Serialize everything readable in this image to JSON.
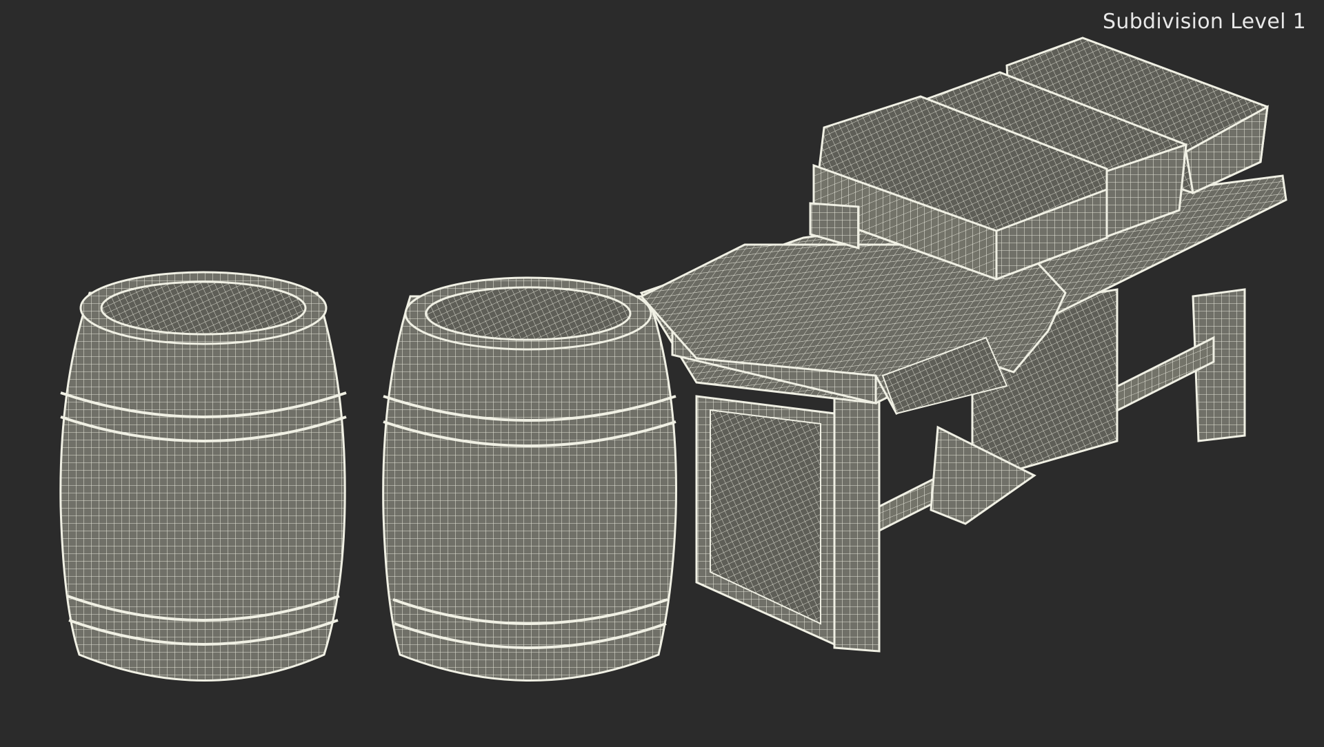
{
  "viewport": {
    "subdivision_label": "Subdivision Level 1",
    "background_color": "#2b2b2b",
    "mesh_fill_color": "#6e6e66",
    "wire_color": "#ecece2"
  }
}
